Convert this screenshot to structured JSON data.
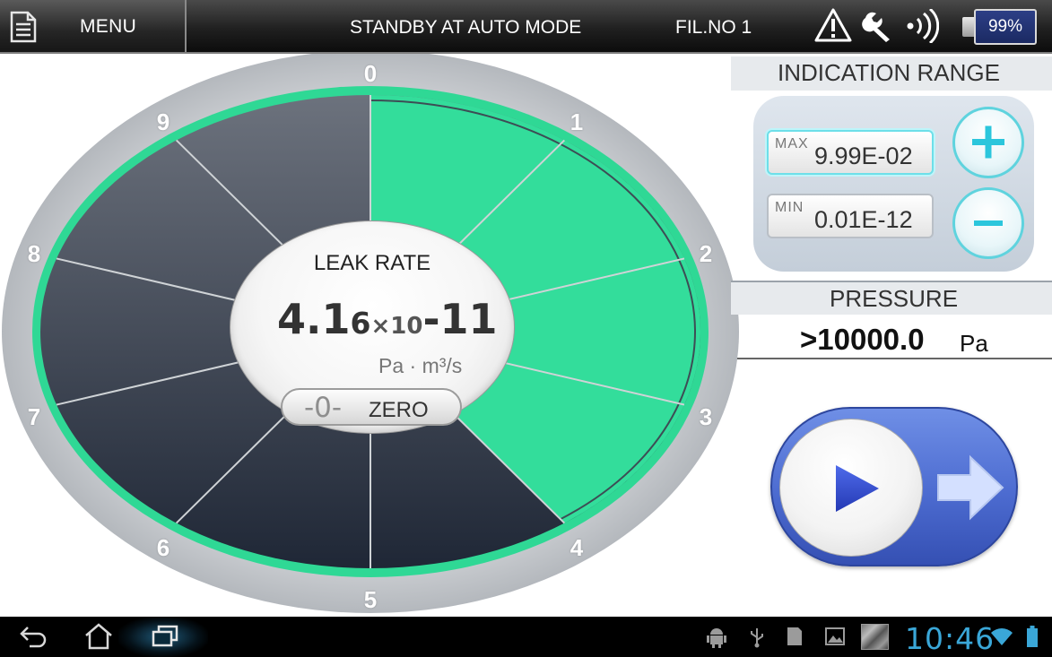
{
  "topbar": {
    "menu_label": "MENU",
    "status": "STANDBY AT AUTO MODE",
    "filament": "FIL.NO 1",
    "battery": "99%",
    "icons": [
      "document-icon",
      "warning-icon",
      "wrench-icon",
      "signal-icon",
      "battery-icon"
    ]
  },
  "gauge": {
    "dial_numbers": [
      "0",
      "1",
      "2",
      "3",
      "4",
      "5",
      "6",
      "7",
      "8",
      "9"
    ],
    "level_fraction": 0.4,
    "colors": {
      "active": "#33dd9b",
      "inactive_top": "#6c727d",
      "inactive_bottom": "#1f2736",
      "bezel": "#c3c6ca"
    },
    "leak_title": "LEAK RATE",
    "mantissa": "4.1",
    "mantissa_small": "6",
    "times": "×10",
    "exponent": "-11",
    "unit": "Pa · m³/s",
    "zero_icon": "-0-",
    "zero_label": "ZERO"
  },
  "range": {
    "title": "INDICATION RANGE",
    "max_label": "MAX",
    "max_value": "9.99E-02",
    "min_label": "MIN",
    "min_value": "0.01E-12"
  },
  "pressure": {
    "title": "PRESSURE",
    "value": ">10000.0",
    "unit": "Pa"
  },
  "navbar": {
    "clock": "10:46",
    "icons": [
      "back-icon",
      "home-icon",
      "recent-apps-icon",
      "android-debug-icon",
      "usb-icon",
      "sd-card-icon",
      "image-icon",
      "thumbnail-icon",
      "wifi-icon",
      "battery-status-icon"
    ]
  }
}
